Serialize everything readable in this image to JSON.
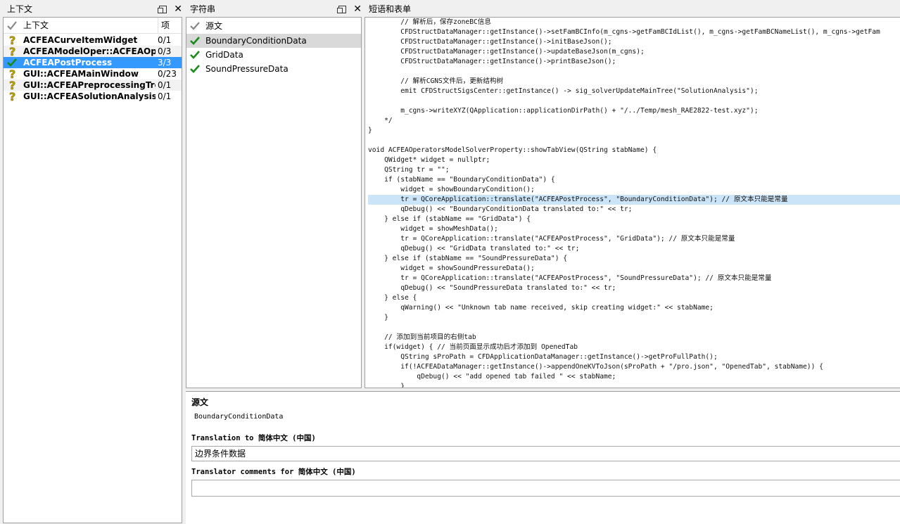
{
  "panels": {
    "context_title": "上下文",
    "strings_title": "字符串",
    "code_title": "短语和表单"
  },
  "context": {
    "col_name": "上下文",
    "col_count": "项",
    "items": [
      {
        "name": "ACFEACurveItemWidget",
        "count": "0/1",
        "status": "question"
      },
      {
        "name": "ACFEAModelOper::ACFEAOpe…",
        "count": "0/3",
        "status": "question"
      },
      {
        "name": "ACFEAPostProcess",
        "count": "3/3",
        "status": "done"
      },
      {
        "name": "GUI::ACFEAMainWindow",
        "count": "0/23",
        "status": "question"
      },
      {
        "name": "GUI::ACFEAPreprocessingTree…",
        "count": "0/1",
        "status": "question"
      },
      {
        "name": "GUI::ACFEASolutionAnalysisTr…",
        "count": "0/1",
        "status": "question"
      }
    ]
  },
  "strings": {
    "items": [
      {
        "text": "源文",
        "status": "header"
      },
      {
        "text": "BoundaryConditionData",
        "status": "done"
      },
      {
        "text": "GridData",
        "status": "done"
      },
      {
        "text": "SoundPressureData",
        "status": "done"
      }
    ]
  },
  "code": {
    "lines": [
      "        // 解析后，保存zoneBC信息",
      "        CFDStructDataManager::getInstance()->setFamBCInfo(m_cgns->getFamBCIdList(), m_cgns->getFamBCNameList(), m_cgns->getFam",
      "        CFDStructDataManager::getInstance()->initBaseJson();",
      "        CFDStructDataManager::getInstance()->updateBaseJson(m_cgns);",
      "        CFDStructDataManager::getInstance()->printBaseJson();",
      "",
      "        // 解析CGNS文件后，更新结构树",
      "        emit CFDStructSigsCenter::getInstance() -> sig_solverUpdateMainTree(\"SolutionAnalysis\");",
      "",
      "        m_cgns->writeXYZ(QApplication::applicationDirPath() + \"/../Temp/mesh_RAE2822-test.xyz\");",
      "    */",
      "}",
      "",
      "void ACFEAOperatorsModelSolverProperty::showTabView(QString stabName) {",
      "    QWidget* widget = nullptr;",
      "    QString tr = \"\";",
      "    if (stabName == \"BoundaryConditionData\") {",
      "        widget = showBoundaryCondition();",
      "        tr = QCoreApplication::translate(\"ACFEAPostProcess\", \"BoundaryConditionData\"); // 原文本只能是常量",
      "        qDebug() << \"BoundaryConditionData translated to:\" << tr;",
      "    } else if (stabName == \"GridData\") {",
      "        widget = showMeshData();",
      "        tr = QCoreApplication::translate(\"ACFEAPostProcess\", \"GridData\"); // 原文本只能是常量",
      "        qDebug() << \"GridData translated to:\" << tr;",
      "    } else if (stabName == \"SoundPressureData\") {",
      "        widget = showSoundPressureData();",
      "        tr = QCoreApplication::translate(\"ACFEAPostProcess\", \"SoundPressureData\"); // 原文本只能是常量",
      "        qDebug() << \"SoundPressureData translated to:\" << tr;",
      "    } else {",
      "        qWarning() << \"Unknown tab name received, skip creating widget:\" << stabName;",
      "    }",
      "",
      "    // 添加到当前项目的右侧tab",
      "    if(widget) { // 当前页面显示成功后才添加到 OpenedTab",
      "        QString sProPath = CFDApplicationDataManager::getInstance()->getProFullPath();",
      "        if(!ACFEADataManager::getInstance()->appendOneKVToJson(sProPath + \"/pro.json\", \"OpenedTab\", stabName)) {",
      "            qDebug() << \"add opened tab failed \" << stabName;",
      "        }"
    ]
  },
  "editor": {
    "source_label": "源文",
    "source_text": "BoundaryConditionData",
    "translation_label": "Translation to 简体中文 (中国)",
    "translation_value": "边界条件数据",
    "comments_label": "Translator comments for 简体中文 (中国)",
    "comments_value": ""
  }
}
